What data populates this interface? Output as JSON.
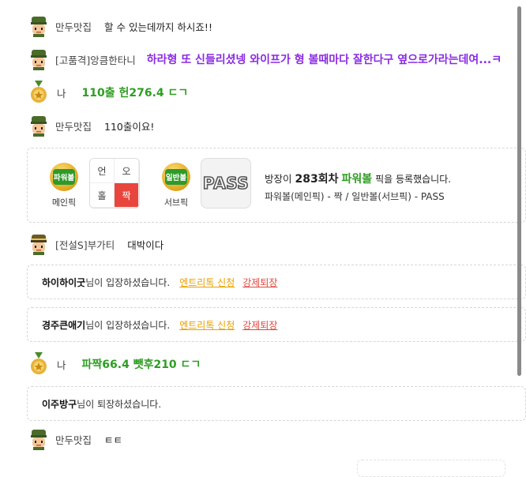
{
  "messages": [
    {
      "nick": "만두맛집",
      "text": "할 수 있는데까지 하시죠!!"
    },
    {
      "nick": "[고품격]앙큼한타니",
      "text": "하라형 또 신들리셨넹 와이프가 형 볼때마다 잘한다구 옆으로가라는데여...ㅋ"
    },
    {
      "nick": "나",
      "text": "110출 헌276.4 ㄷㄱ"
    },
    {
      "nick": "만두맛집",
      "text": "110출이요!"
    },
    {
      "nick": "[전설S]부가티",
      "text": "대박이다"
    },
    {
      "nick": "나",
      "text": "파짝66.4 뺏후210 ㄷㄱ"
    },
    {
      "nick": "만두맛집",
      "text": "ㅌㅌ"
    }
  ],
  "pick": {
    "main_badge": "파워볼",
    "main_label": "메인픽",
    "main_grid": [
      "언",
      "오",
      "홀",
      "짝"
    ],
    "main_selected": "짝",
    "sub_badge": "일반볼",
    "sub_label": "서브픽",
    "sub_value": "PASS",
    "line1_prefix": "방장이",
    "line1_round": "283회차",
    "line1_game": "파워볼",
    "line1_suffix": "픽을 등록했습니다.",
    "line2": "파워볼(메인픽) - 짝 / 일반볼(서브픽) - PASS"
  },
  "system": [
    {
      "user": "하이하이굿",
      "text": "님이 입장하셨습니다.",
      "link1": "엔트리톡 신청",
      "link2": "강제퇴장"
    },
    {
      "user": "경주큰애기",
      "text": "님이 입장하셨습니다.",
      "link1": "엔트리톡 신청",
      "link2": "강제퇴장"
    },
    {
      "user": "이주방구",
      "text": "님이 퇴장하셨습니다."
    }
  ],
  "colors": {
    "highlight_purple": "#8a2be2",
    "highlight_green": "#2e9e22",
    "selected_red": "#e8463c",
    "link_orange": "#e8a000",
    "link_red": "#e0463c"
  }
}
